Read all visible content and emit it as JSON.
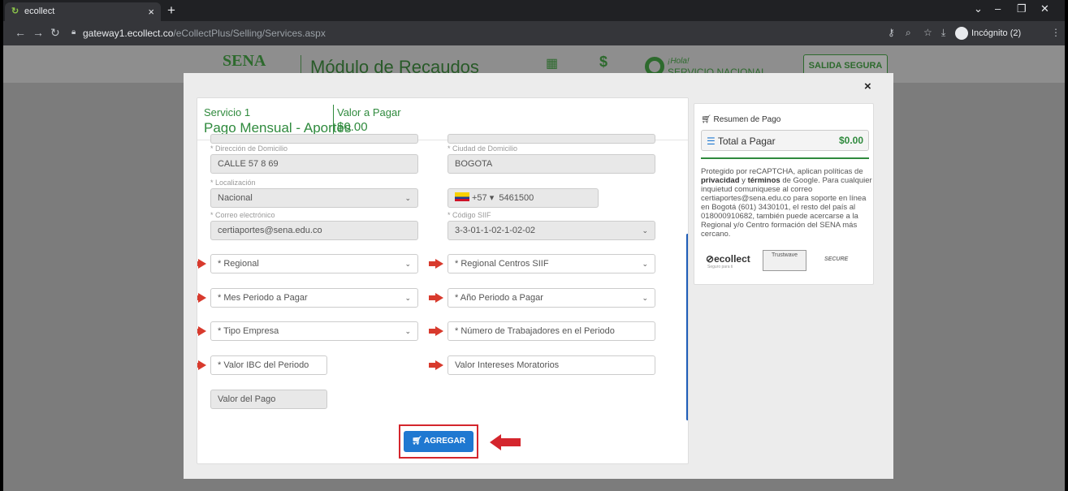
{
  "browser": {
    "tab_title": "ecollect",
    "tab_close": "×",
    "new_tab": "+",
    "url_host": "gateway1.ecollect.co",
    "url_path": "/eCollectPlus/Selling/Services.aspx",
    "incognito_label": "Incógnito (2)"
  },
  "site": {
    "logo_text": "SENA",
    "module_title": "Módulo de Recaudos",
    "greeting": "¡Hola!",
    "user": "SERVICIO NACIONAL",
    "logout_label": "SALIDA SEGURA"
  },
  "modal": {
    "close_label": "×",
    "service_number": "Servicio 1",
    "service_name": "Pago Mensual - Aportes",
    "value_label": "Valor a Pagar",
    "value_amount": "$0.00",
    "fields": {
      "address_label": "* Dirección de Domicilio",
      "address_value": "CALLE 57 8 69",
      "city_label": "* Ciudad de Domicilio",
      "city_value": "BOGOTA",
      "location_label": "* Localización",
      "location_value": "Nacional",
      "phone_code": "+57 ▾",
      "phone_value": "5461500",
      "email_label": "* Correo electrónico",
      "email_value": "certiaportes@sena.edu.co",
      "siif_label": "* Código SIIF",
      "siif_value": "3-3-01-1-02-1-02-02",
      "regional_ph": "* Regional",
      "regional_siif_ph": "* Regional Centros SIIF",
      "month_ph": "* Mes Periodo a Pagar",
      "year_ph": "* Año Periodo a Pagar",
      "company_type_ph": "* Tipo Empresa",
      "workers_ph": "* Número de Trabajadores en el Periodo",
      "ibc_ph": "* Valor IBC del Periodo",
      "interest_ph": "Valor Intereses Moratorios",
      "payment_ph": "Valor del Pago"
    },
    "add_button": "AGREGAR"
  },
  "summary": {
    "title": "Resumen de Pago",
    "total_label": "Total a Pagar",
    "total_value": "$0.00",
    "legal_1": "Protegido por reCAPTCHA, aplican políticas de ",
    "legal_privacy": "privacidad",
    "legal_2": " y ",
    "legal_terms": "términos",
    "legal_3": " de Google. Para cualquier inquietud comuniquese al correo certiaportes@sena.edu.co para soporte en línea en Bogotá (601) 3430101, el resto del país al 018000910682, también puede acercarse a la Regional y/o Centro formación del SENA más cercano.",
    "logo_ecollect": "ecollect",
    "logo_ecollect_sub": "Seguro para ti",
    "logo_trustwave": "Trustwave",
    "logo_secure": "SECURE"
  },
  "colors": {
    "accent_green": "#2f8a3d",
    "button_blue": "#1f78d1",
    "highlight_red": "#d4262d"
  }
}
